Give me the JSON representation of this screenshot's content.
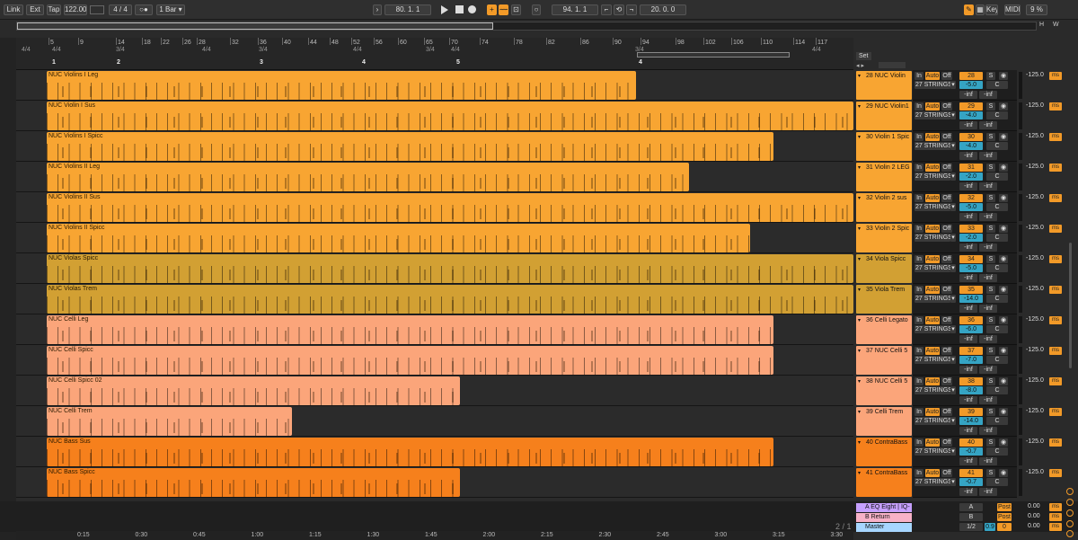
{
  "transport": {
    "link": "Link",
    "ext": "Ext",
    "tap": "Tap",
    "tempo": "122.00",
    "signature": "4 / 4",
    "metronome": "○●",
    "quantize": "1 Bar",
    "arrangement_position": "80.   1.   1",
    "loop_start": "94.   1.   1",
    "loop_length": "20.   0.   0",
    "key": "Key",
    "midi": "MIDI",
    "cpu": "9 %"
  },
  "ruler_bars": [
    "5",
    "9",
    "14",
    "18",
    "22",
    "26",
    "28",
    "32",
    "36",
    "40",
    "44",
    "48",
    "52",
    "56",
    "60",
    "65",
    "70",
    "74",
    "78",
    "82",
    "86",
    "90",
    "94",
    "98",
    "102",
    "106",
    "110",
    "114",
    "117"
  ],
  "signatures": [
    "4/4",
    "4/4",
    "3/4",
    "4/4",
    "3/4",
    "4/4",
    "3/4",
    "4/4",
    "3/4",
    "4/4",
    "4/4"
  ],
  "locators": [
    "1",
    "2",
    "3",
    "4",
    "5",
    "4"
  ],
  "set_label": "Set",
  "tracks": [
    {
      "clip": "NUC Violins I Leg",
      "name": "28 NUC Violin",
      "input": "27 STRINGS",
      "num": "28",
      "vol": "-5.0",
      "pan": "C",
      "meter": "-125.0"
    },
    {
      "clip": "NUC Violin I Sus",
      "name": "29 NUC Violin1",
      "input": "27 STRINGS",
      "num": "29",
      "vol": "-4.0",
      "pan": "C",
      "meter": "-125.0"
    },
    {
      "clip": "NUC Violins I Spicc",
      "name": "30 Violin 1 Spic",
      "input": "27 STRINGS",
      "num": "30",
      "vol": "-4.0",
      "pan": "C",
      "meter": "-125.0"
    },
    {
      "clip": "NUC Violins II Leg",
      "name": "31 Violin 2 LEG",
      "input": "27 STRINGS",
      "num": "31",
      "vol": "-2.0",
      "pan": "C",
      "meter": "-125.0"
    },
    {
      "clip": "NUC Violins II Sus",
      "name": "32 Violin 2 sus",
      "input": "27 STRINGS",
      "num": "32",
      "vol": "-5.0",
      "pan": "C",
      "meter": "-125.0"
    },
    {
      "clip": "NUC Violins II Spicc",
      "name": "33 Violin 2 Spic",
      "input": "27 STRINGS",
      "num": "33",
      "vol": "-2.0",
      "pan": "C",
      "meter": "-125.0"
    },
    {
      "clip": "NUC Violas Spicc",
      "name": "34 Viola Spicc",
      "input": "27 STRINGS",
      "num": "34",
      "vol": "-5.0",
      "pan": "C",
      "meter": "-125.0"
    },
    {
      "clip": "NUC Violas Trem",
      "name": "35 Viola Trem",
      "input": "27 STRINGS",
      "num": "35",
      "vol": "-14.0",
      "pan": "C",
      "meter": "-125.0"
    },
    {
      "clip": "NUC Celli Leg",
      "name": "36 Celli Legato",
      "input": "27 STRINGS",
      "num": "36",
      "vol": "-6.0",
      "pan": "C",
      "meter": "-125.0"
    },
    {
      "clip": "NUC Celli Spicc",
      "name": "37 NUC Celli 5",
      "input": "27 STRINGS",
      "num": "37",
      "vol": "-7.0",
      "pan": "C",
      "meter": "-125.0"
    },
    {
      "clip": "NUC Celli Spicc 02",
      "name": "38 NUC Celli 5",
      "input": "27 STRINGS",
      "num": "38",
      "vol": "-8.0",
      "pan": "C",
      "meter": "-125.0"
    },
    {
      "clip": "NUC Celli Trem",
      "name": "39 Celli Trem",
      "input": "27 STRINGS",
      "num": "39",
      "vol": "-14.0",
      "pan": "C",
      "meter": "-125.0"
    },
    {
      "clip": "NUC Bass Sus",
      "name": "40 ContraBass",
      "input": "27 STRINGS",
      "num": "40",
      "vol": "-0.7",
      "pan": "C",
      "meter": "-125.0"
    },
    {
      "clip": "NUC Bass Spicc",
      "name": "41 ContraBass",
      "input": "27 STRINGS",
      "num": "41",
      "vol": "-0.7",
      "pan": "C",
      "meter": "-125.0"
    }
  ],
  "mixer_labels": {
    "in": "In",
    "auto": "Auto",
    "off": "Off",
    "s": "S",
    "inf1": "-inf",
    "inf2": "-inf",
    "ms": "ms"
  },
  "returns": [
    {
      "name": "A EQ Eight | IQ-",
      "letter": "A",
      "post": "Post",
      "vol": "0.00",
      "ms": "ms"
    },
    {
      "name": "B Return",
      "letter": "B",
      "post": "Post",
      "vol": "0.00",
      "ms": "ms"
    },
    {
      "name": "Master",
      "letter": "1/2",
      "post": "0",
      "extra": "0.9",
      "vol": "0.00",
      "ms": "ms"
    }
  ],
  "page_indicator": "2 / 1",
  "timeline": [
    "0:15",
    "0:30",
    "0:45",
    "1:00",
    "1:15",
    "1:30",
    "1:45",
    "2:00",
    "2:15",
    "2:30",
    "2:45",
    "3:00",
    "3:15",
    "3:30"
  ],
  "colors": {
    "orange": "#f8a532",
    "gold": "#d2a033",
    "salmon": "#fba57a",
    "deep_orange": "#f6801c",
    "accent": "#f29a28"
  }
}
